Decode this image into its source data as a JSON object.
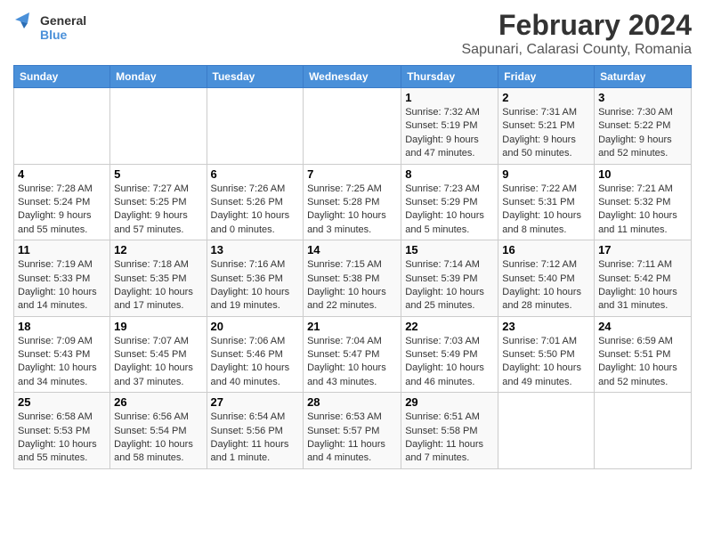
{
  "header": {
    "logo_general": "General",
    "logo_blue": "Blue",
    "title": "February 2024",
    "subtitle": "Sapunari, Calarasi County, Romania"
  },
  "days_of_week": [
    "Sunday",
    "Monday",
    "Tuesday",
    "Wednesday",
    "Thursday",
    "Friday",
    "Saturday"
  ],
  "weeks": [
    [
      {
        "day": "",
        "info": ""
      },
      {
        "day": "",
        "info": ""
      },
      {
        "day": "",
        "info": ""
      },
      {
        "day": "",
        "info": ""
      },
      {
        "day": "1",
        "info": "Sunrise: 7:32 AM\nSunset: 5:19 PM\nDaylight: 9 hours and 47 minutes."
      },
      {
        "day": "2",
        "info": "Sunrise: 7:31 AM\nSunset: 5:21 PM\nDaylight: 9 hours and 50 minutes."
      },
      {
        "day": "3",
        "info": "Sunrise: 7:30 AM\nSunset: 5:22 PM\nDaylight: 9 hours and 52 minutes."
      }
    ],
    [
      {
        "day": "4",
        "info": "Sunrise: 7:28 AM\nSunset: 5:24 PM\nDaylight: 9 hours and 55 minutes."
      },
      {
        "day": "5",
        "info": "Sunrise: 7:27 AM\nSunset: 5:25 PM\nDaylight: 9 hours and 57 minutes."
      },
      {
        "day": "6",
        "info": "Sunrise: 7:26 AM\nSunset: 5:26 PM\nDaylight: 10 hours and 0 minutes."
      },
      {
        "day": "7",
        "info": "Sunrise: 7:25 AM\nSunset: 5:28 PM\nDaylight: 10 hours and 3 minutes."
      },
      {
        "day": "8",
        "info": "Sunrise: 7:23 AM\nSunset: 5:29 PM\nDaylight: 10 hours and 5 minutes."
      },
      {
        "day": "9",
        "info": "Sunrise: 7:22 AM\nSunset: 5:31 PM\nDaylight: 10 hours and 8 minutes."
      },
      {
        "day": "10",
        "info": "Sunrise: 7:21 AM\nSunset: 5:32 PM\nDaylight: 10 hours and 11 minutes."
      }
    ],
    [
      {
        "day": "11",
        "info": "Sunrise: 7:19 AM\nSunset: 5:33 PM\nDaylight: 10 hours and 14 minutes."
      },
      {
        "day": "12",
        "info": "Sunrise: 7:18 AM\nSunset: 5:35 PM\nDaylight: 10 hours and 17 minutes."
      },
      {
        "day": "13",
        "info": "Sunrise: 7:16 AM\nSunset: 5:36 PM\nDaylight: 10 hours and 19 minutes."
      },
      {
        "day": "14",
        "info": "Sunrise: 7:15 AM\nSunset: 5:38 PM\nDaylight: 10 hours and 22 minutes."
      },
      {
        "day": "15",
        "info": "Sunrise: 7:14 AM\nSunset: 5:39 PM\nDaylight: 10 hours and 25 minutes."
      },
      {
        "day": "16",
        "info": "Sunrise: 7:12 AM\nSunset: 5:40 PM\nDaylight: 10 hours and 28 minutes."
      },
      {
        "day": "17",
        "info": "Sunrise: 7:11 AM\nSunset: 5:42 PM\nDaylight: 10 hours and 31 minutes."
      }
    ],
    [
      {
        "day": "18",
        "info": "Sunrise: 7:09 AM\nSunset: 5:43 PM\nDaylight: 10 hours and 34 minutes."
      },
      {
        "day": "19",
        "info": "Sunrise: 7:07 AM\nSunset: 5:45 PM\nDaylight: 10 hours and 37 minutes."
      },
      {
        "day": "20",
        "info": "Sunrise: 7:06 AM\nSunset: 5:46 PM\nDaylight: 10 hours and 40 minutes."
      },
      {
        "day": "21",
        "info": "Sunrise: 7:04 AM\nSunset: 5:47 PM\nDaylight: 10 hours and 43 minutes."
      },
      {
        "day": "22",
        "info": "Sunrise: 7:03 AM\nSunset: 5:49 PM\nDaylight: 10 hours and 46 minutes."
      },
      {
        "day": "23",
        "info": "Sunrise: 7:01 AM\nSunset: 5:50 PM\nDaylight: 10 hours and 49 minutes."
      },
      {
        "day": "24",
        "info": "Sunrise: 6:59 AM\nSunset: 5:51 PM\nDaylight: 10 hours and 52 minutes."
      }
    ],
    [
      {
        "day": "25",
        "info": "Sunrise: 6:58 AM\nSunset: 5:53 PM\nDaylight: 10 hours and 55 minutes."
      },
      {
        "day": "26",
        "info": "Sunrise: 6:56 AM\nSunset: 5:54 PM\nDaylight: 10 hours and 58 minutes."
      },
      {
        "day": "27",
        "info": "Sunrise: 6:54 AM\nSunset: 5:56 PM\nDaylight: 11 hours and 1 minute."
      },
      {
        "day": "28",
        "info": "Sunrise: 6:53 AM\nSunset: 5:57 PM\nDaylight: 11 hours and 4 minutes."
      },
      {
        "day": "29",
        "info": "Sunrise: 6:51 AM\nSunset: 5:58 PM\nDaylight: 11 hours and 7 minutes."
      },
      {
        "day": "",
        "info": ""
      },
      {
        "day": "",
        "info": ""
      }
    ]
  ]
}
